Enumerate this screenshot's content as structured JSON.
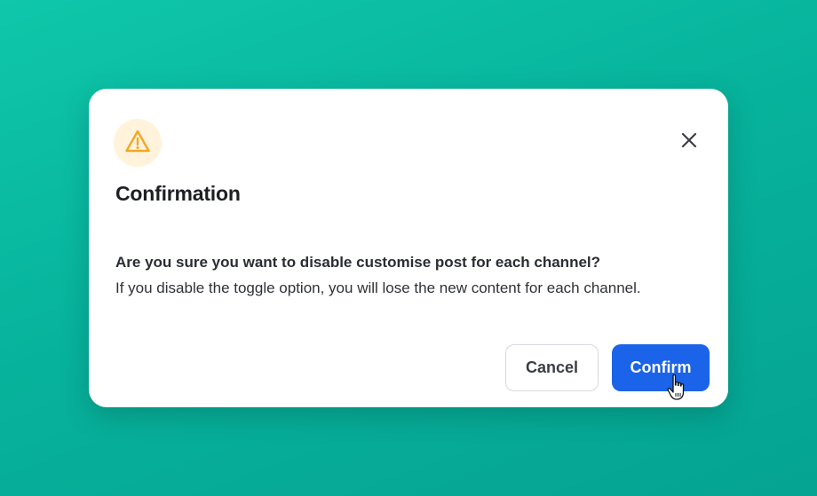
{
  "dialog": {
    "title": "Confirmation",
    "question": "Are you sure you want to disable customise post for each channel?",
    "detail": "If you disable the toggle option, you will lose the new content for each channel.",
    "cancel_label": "Cancel",
    "confirm_label": "Confirm",
    "icons": {
      "header": "warning-triangle-icon",
      "close": "close-icon",
      "pointer": "hand-pointer-cursor-icon"
    }
  },
  "colors": {
    "background": "#08b9a0",
    "primary": "#1b63e8",
    "warning": "#f5a524",
    "warning_bg": "#fff3dc"
  }
}
